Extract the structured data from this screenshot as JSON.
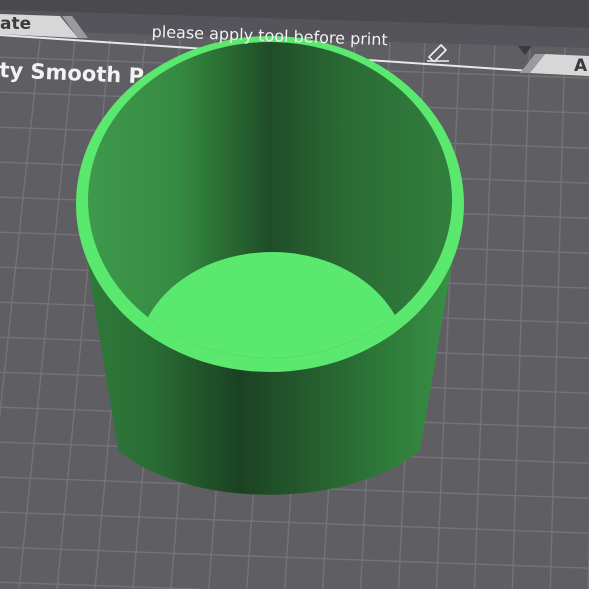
{
  "tabs": {
    "left_label": "ate",
    "right_label": "A"
  },
  "plate": {
    "title": "ty Smooth P",
    "note": "please apply tool before print"
  },
  "icons": {
    "edit": "pencil-edit-icon"
  },
  "model": {
    "color": "#5be86e",
    "shape": "open-cylinder"
  },
  "colors": {
    "background": "#5f5e63",
    "grid": "#747379",
    "model_light": "#5be86e",
    "model_dark": "#1e4d26"
  }
}
